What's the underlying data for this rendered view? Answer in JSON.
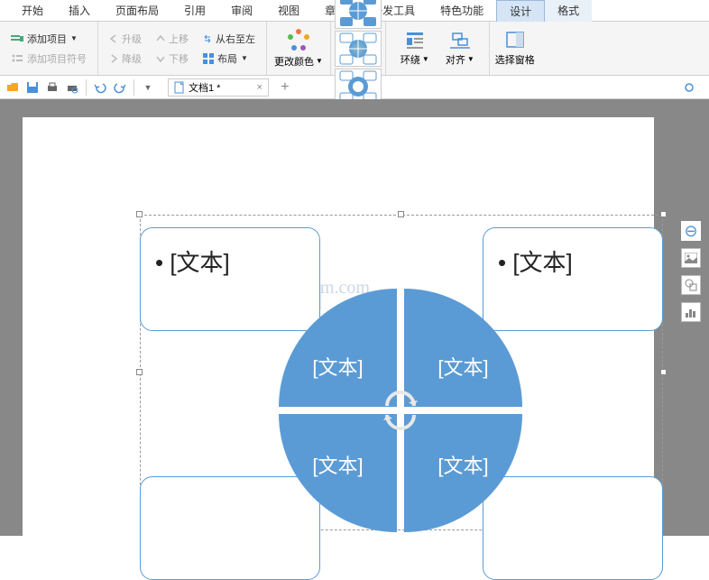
{
  "menubar": {
    "items": [
      "开始",
      "插入",
      "页面布局",
      "引用",
      "审阅",
      "视图",
      "章节",
      "开发工具",
      "特色功能",
      "设计",
      "格式"
    ],
    "active_index": 9
  },
  "ribbon": {
    "add_item": "添加项目",
    "add_bullet": "添加项目符号",
    "promote": "升级",
    "demote": "降级",
    "move_up": "上移",
    "move_down": "下移",
    "rtl": "从右至左",
    "layout": "布局",
    "change_color": "更改颜色",
    "wrap": "环绕",
    "align": "对齐",
    "selection_pane": "选择窗格"
  },
  "qat": {
    "doc_title": "文档1 *"
  },
  "smartart": {
    "placeholder": "[文本]"
  },
  "watermark": "system.com"
}
